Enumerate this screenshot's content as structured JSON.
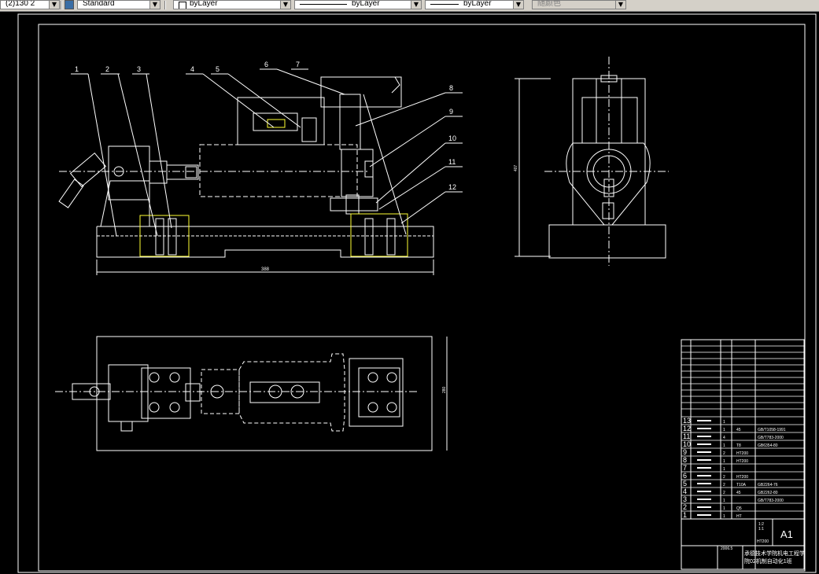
{
  "toolbar": {
    "scale_combo": "(2)130 2",
    "text_style": "Standard",
    "layer_combo": "byLayer",
    "linetype_combo": "byLayer",
    "lineweight_combo": "byLayer",
    "color_combo": "随颜色"
  },
  "drawing": {
    "part_numbers": [
      "1",
      "2",
      "3",
      "4",
      "5",
      "6",
      "7",
      "8",
      "9",
      "10",
      "11",
      "12"
    ],
    "dim_length": "388",
    "dim_height_side": "407",
    "dim_height_top": "280"
  },
  "title_block": {
    "sheet_size": "A1",
    "rows": [
      {
        "no": "13",
        "qty": "1",
        "mat": "",
        "std": ""
      },
      {
        "no": "12",
        "qty": "1",
        "mat": "45",
        "std": "GB/T1058-1991"
      },
      {
        "no": "11",
        "qty": "4",
        "mat": "",
        "std": "GB/T783-2000"
      },
      {
        "no": "10",
        "qty": "1",
        "mat": "T8",
        "std": "GB6354-80"
      },
      {
        "no": "9",
        "qty": "2",
        "mat": "HT200",
        "std": ""
      },
      {
        "no": "8",
        "qty": "1",
        "mat": "HT200",
        "std": ""
      },
      {
        "no": "7",
        "qty": "1",
        "mat": "",
        "std": ""
      },
      {
        "no": "6",
        "qty": "2",
        "mat": "HT200",
        "std": ""
      },
      {
        "no": "5",
        "qty": "2",
        "mat": "T10A",
        "std": "GB2264-76"
      },
      {
        "no": "4",
        "qty": "2",
        "mat": "45",
        "std": "GB2262-80"
      },
      {
        "no": "3",
        "qty": "1",
        "mat": "",
        "std": "GB/T783-2000"
      },
      {
        "no": "2",
        "qty": "1",
        "mat": "Q5",
        "std": ""
      },
      {
        "no": "1",
        "qty": "1",
        "mat": "HT",
        "std": ""
      }
    ],
    "scale": "1:1",
    "material": "HT200",
    "weight_label": "1:2",
    "school_line1": "承德技术学院机电工程学",
    "school_line2": "院02机制自动化1班",
    "drawing_no": "2006.5"
  }
}
